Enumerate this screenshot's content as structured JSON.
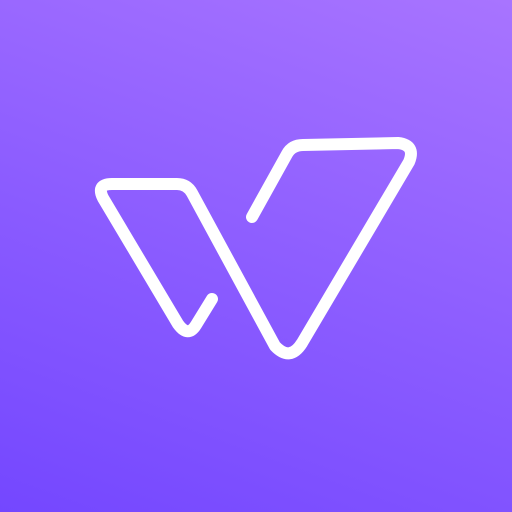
{
  "icon": {
    "semantic": "w-letter-logo-icon",
    "colors": {
      "background_start": "#a874ff",
      "background_mid": "#8a5bff",
      "background_end": "#7447ff",
      "stroke": "#ffffff"
    }
  }
}
